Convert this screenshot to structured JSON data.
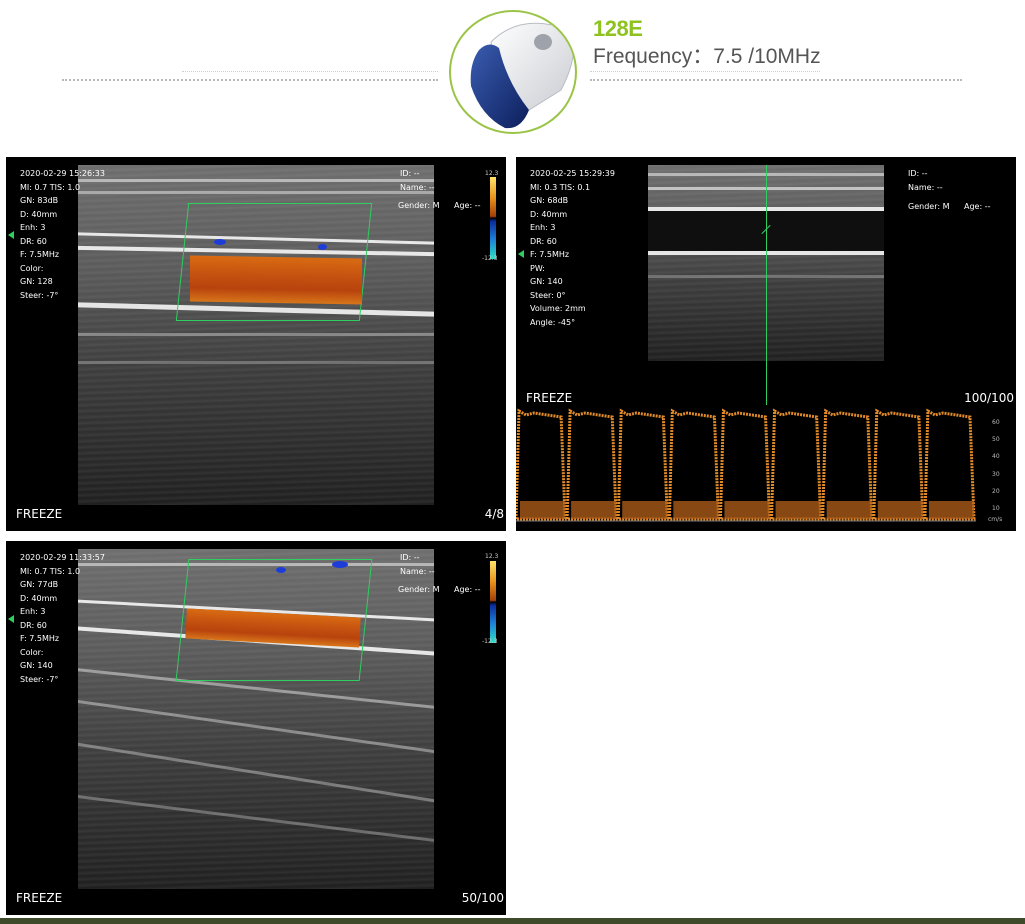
{
  "header": {
    "model": "128E",
    "frequency": "Frequency：7.5 /10MHz",
    "probe_icon": "ultrasound-probe-icon",
    "accent_color": "#8dc21f"
  },
  "panel1": {
    "info": [
      "2020-02-29 15:26:33",
      "MI: 0.7  TIS: 1.0",
      "GN: 83dB",
      "D: 40mm",
      "Enh: 3",
      "DR: 60",
      "F: 7.5MHz",
      "Color:",
      "GN: 128",
      "Steer: -7°"
    ],
    "patient": [
      "ID: --",
      "Name: --",
      "Gender: M",
      "Age: --"
    ],
    "scale_top": "12.3",
    "scale_bottom": "-12.3",
    "freeze": "FREEZE",
    "frames": "4/8"
  },
  "panel2": {
    "info": [
      "2020-02-25 15:29:39",
      "MI: 0.3  TIS: 0.1",
      "GN: 68dB",
      "D: 40mm",
      "Enh: 3",
      "DR: 60",
      "F: 7.5MHz",
      "PW:",
      "GN: 140",
      "Steer: 0°",
      "Volume: 2mm",
      "Angle: -45°"
    ],
    "patient": [
      "ID: --",
      "Name: --",
      "Gender: M",
      "Age: --"
    ],
    "freeze": "FREEZE",
    "frames": "100/100",
    "velocity_ticks": [
      "60",
      "50",
      "40",
      "30",
      "20",
      "10"
    ],
    "velocity_unit": "cm/s"
  },
  "panel3": {
    "info": [
      "2020-02-29 11:33:57",
      "MI: 0.7  TIS: 1.0",
      "GN: 77dB",
      "D: 40mm",
      "Enh: 3",
      "DR: 60",
      "F: 7.5MHz",
      "Color:",
      "GN: 140",
      "Steer: -7°"
    ],
    "patient": [
      "ID: --",
      "Name: --",
      "Gender: M",
      "Age: --"
    ],
    "scale_top": "12.3",
    "scale_bottom": "-12.3",
    "freeze": "FREEZE",
    "frames": "50/100"
  }
}
